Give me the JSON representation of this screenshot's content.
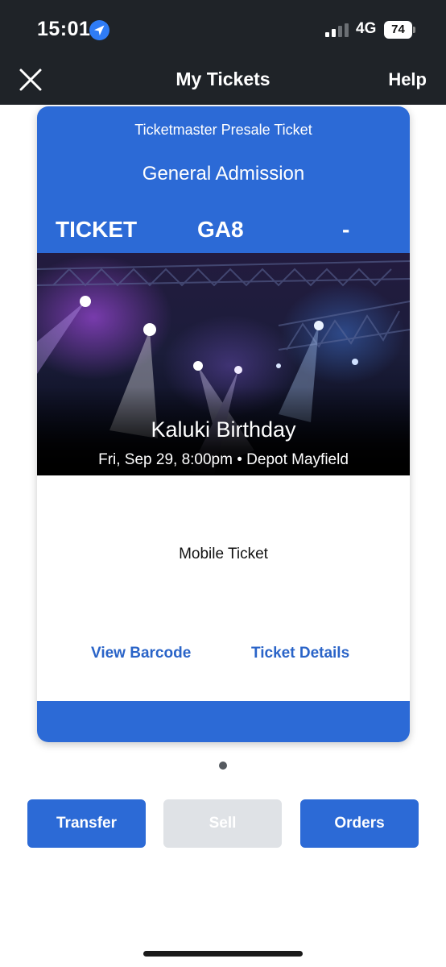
{
  "status_bar": {
    "time": "15:01",
    "network": "4G",
    "battery": "74"
  },
  "nav": {
    "title": "My Tickets",
    "help_label": "Help"
  },
  "ticket": {
    "presale_label": "Ticketmaster Presale Ticket",
    "admission_type": "General Admission",
    "row_labels": [
      "TICKET",
      "GA8",
      "-"
    ],
    "event_name": "Kaluki Birthday",
    "event_meta": "Fri, Sep 29, 8:00pm • Depot Mayfield",
    "mobile_ticket_label": "Mobile Ticket",
    "view_barcode_label": "View Barcode",
    "ticket_details_label": "Ticket Details"
  },
  "actions": {
    "transfer_label": "Transfer",
    "sell_label": "Sell",
    "orders_label": "Orders"
  },
  "colors": {
    "header_bg": "#1f2328",
    "brand_blue": "#2c6ad6",
    "link_blue": "#2a64c8",
    "disabled_bg": "#dfe2e6"
  },
  "icons": {
    "location": "location-arrow-icon",
    "signal": "cellular-signal-icon",
    "battery": "battery-icon",
    "close": "close-icon"
  }
}
